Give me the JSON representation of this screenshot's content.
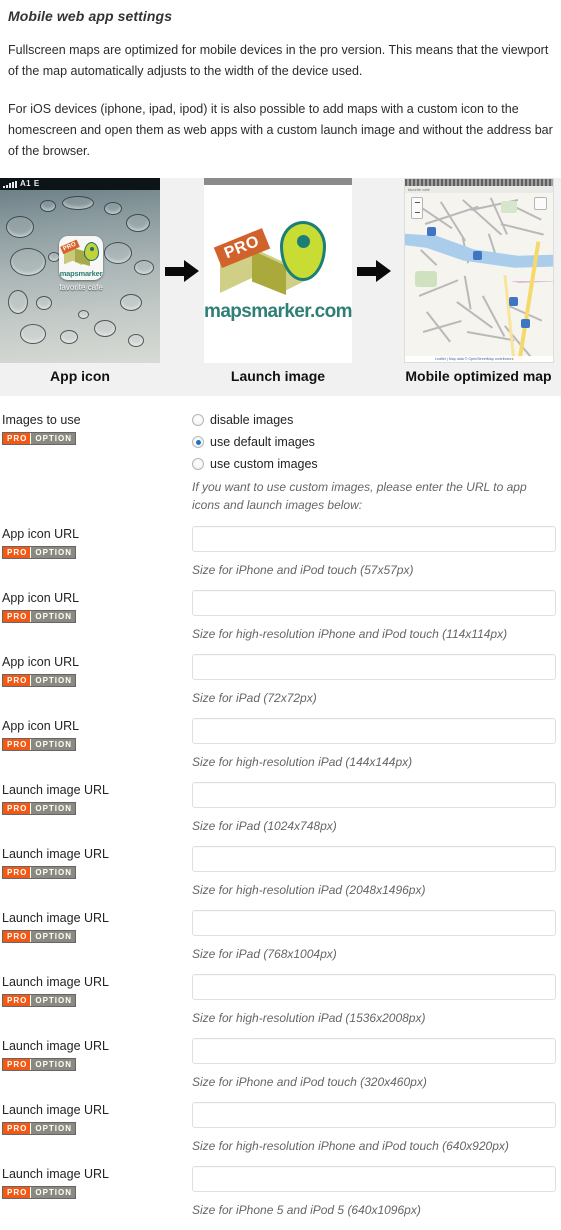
{
  "section": {
    "heading": "Mobile web app settings",
    "paragraphs": [
      "Fullscreen maps are optimized for mobile devices in the pro version. This means that the viewport of the map automatically adjusts to the width of the device used.",
      "For iOS devices (iphone, ipad, ipod) it is also possible to add maps with a custom icon to the homescreen and open them as web apps with a custom launch image and without the address bar of the browser."
    ]
  },
  "illustration": {
    "panels": [
      {
        "caption": "App icon",
        "status_signal": "A1",
        "status_network": "E",
        "icon_label": "mapsmarker",
        "icon_badge": "PRO",
        "app_title": "favorite cafe"
      },
      {
        "caption": "Launch image",
        "logo_badge": "PRO",
        "logo_text": "mapsmarker.com"
      },
      {
        "caption": "Mobile optimized map",
        "map_title": "favorite cafe",
        "map_attribution": "Leaflet | Map data © OpenStreetMap contributors"
      }
    ],
    "arrow_glyph": "arrow-right"
  },
  "badge": {
    "pro": "PRO",
    "option": "OPTION",
    "pro_color": "#f05a14",
    "option_color": "#8c8a80"
  },
  "images_to_use": {
    "label": "Images to use",
    "options": [
      {
        "label": "disable images",
        "checked": false
      },
      {
        "label": "use default images",
        "checked": true
      },
      {
        "label": "use custom images",
        "checked": false
      }
    ],
    "hint": "If you want to use custom images, please enter the URL to app icons and launch images below:"
  },
  "fields": [
    {
      "label": "App icon URL",
      "value": "",
      "hint": "Size for iPhone and iPod touch (57x57px)"
    },
    {
      "label": "App icon URL",
      "value": "",
      "hint": "Size for high-resolution iPhone and iPod touch (114x114px)"
    },
    {
      "label": "App icon URL",
      "value": "",
      "hint": "Size for iPad (72x72px)"
    },
    {
      "label": "App icon URL",
      "value": "",
      "hint": "Size for high-resolution iPad (144x144px)"
    },
    {
      "label": "Launch image URL",
      "value": "",
      "hint": "Size for iPad (1024x748px)"
    },
    {
      "label": "Launch image URL",
      "value": "",
      "hint": "Size for high-resolution iPad (2048x1496px)"
    },
    {
      "label": "Launch image URL",
      "value": "",
      "hint": "Size for iPad (768x1004px)"
    },
    {
      "label": "Launch image URL",
      "value": "",
      "hint": "Size for high-resolution iPad (1536x2008px)"
    },
    {
      "label": "Launch image URL",
      "value": "",
      "hint": "Size for iPhone and iPod touch (320x460px)"
    },
    {
      "label": "Launch image URL",
      "value": "",
      "hint": "Size for high-resolution iPhone and iPod touch (640x920px)"
    },
    {
      "label": "Launch image URL",
      "value": "",
      "hint": "Size for iPhone 5 and iPod 5 (640x1096px)"
    }
  ]
}
